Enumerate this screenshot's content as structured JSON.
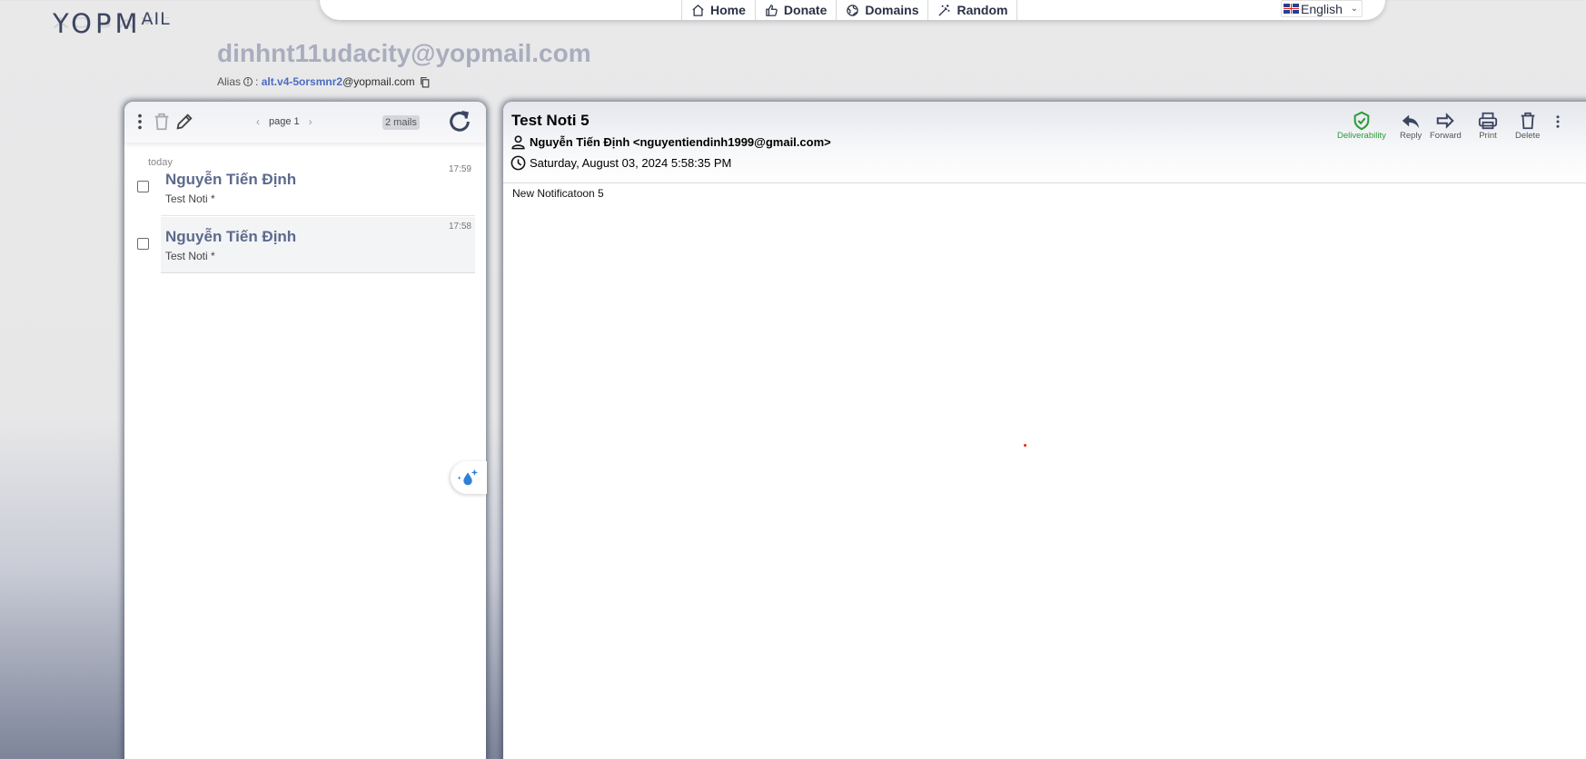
{
  "logo": {
    "text_main": "YOPM",
    "text_small": "AIL"
  },
  "nav": {
    "items": [
      {
        "label": "Home",
        "icon": "home-icon"
      },
      {
        "label": "Donate",
        "icon": "thumbs-up-icon"
      },
      {
        "label": "Domains",
        "icon": "globe-icon"
      },
      {
        "label": "Random",
        "icon": "magic-wand-icon"
      }
    ],
    "language": "English"
  },
  "inbox": {
    "address": "dinhnt11udacity@yopmail.com",
    "alias_label": "Alias",
    "alias_sep": ":",
    "alias_value": "alt.v4-5orsmnr2",
    "alias_domain": "@yopmail.com"
  },
  "mail_list": {
    "page_label": "page 1",
    "mail_count": "2 mails",
    "group_label": "today",
    "items": [
      {
        "from": "Nguyễn Tiến Định",
        "subject": "Test Noti *",
        "time": "17:59"
      },
      {
        "from": "Nguyễn Tiến Định",
        "subject": "Test Noti *",
        "time": "17:58"
      }
    ]
  },
  "message": {
    "subject": "Test Noti 5",
    "from": "Nguyễn Tiến Định <nguyentiendinh1999@gmail.com>",
    "date": "Saturday, August 03, 2024 5:58:35 PM",
    "body": "New Notificatoon 5",
    "actions": {
      "deliverability": "Deliverability",
      "reply": "Reply",
      "forward": "Forward",
      "print": "Print",
      "delete": "Delete"
    }
  },
  "colors": {
    "accent": "#5c6a8c",
    "deliverability": "#2b9c35",
    "brand": "#3c4560"
  }
}
